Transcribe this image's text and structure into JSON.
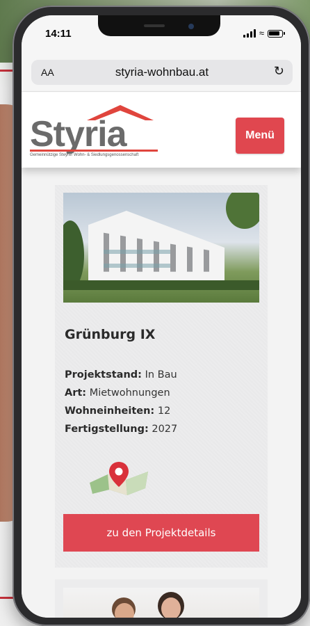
{
  "status_bar": {
    "time": "14:11"
  },
  "browser": {
    "text_size_label": "AA",
    "url": "styria-wohnbau.at",
    "reload_icon": "reload-icon"
  },
  "site": {
    "logo_text": "Styria",
    "logo_subtitle": "Gemeinnützige Steyrer Wohn- & Siedlungsgenossenschaft",
    "menu_label": "Menü",
    "brand_color": "#e0474f"
  },
  "project": {
    "title": "Grünburg IX",
    "facts": [
      {
        "label": "Projektstand:",
        "value": "In Bau"
      },
      {
        "label": "Art:",
        "value": "Mietwohnungen"
      },
      {
        "label": "Wohneinheiten:",
        "value": "12"
      },
      {
        "label": "Fertigstellung:",
        "value": "2027"
      }
    ],
    "map_icon": "map-pin-icon",
    "cta_label": "zu den Projektdetails"
  }
}
